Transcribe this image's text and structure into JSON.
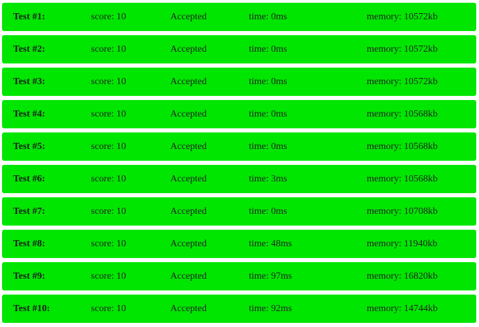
{
  "tests": [
    {
      "name": "Test #1:",
      "score": "score: 10",
      "status": "Accepted",
      "time": "time: 0ms",
      "memory": "memory: 10572kb"
    },
    {
      "name": "Test #2:",
      "score": "score: 10",
      "status": "Accepted",
      "time": "time: 0ms",
      "memory": "memory: 10572kb"
    },
    {
      "name": "Test #3:",
      "score": "score: 10",
      "status": "Accepted",
      "time": "time: 0ms",
      "memory": "memory: 10572kb"
    },
    {
      "name": "Test #4:",
      "score": "score: 10",
      "status": "Accepted",
      "time": "time: 0ms",
      "memory": "memory: 10568kb"
    },
    {
      "name": "Test #5:",
      "score": "score: 10",
      "status": "Accepted",
      "time": "time: 0ms",
      "memory": "memory: 10568kb"
    },
    {
      "name": "Test #6:",
      "score": "score: 10",
      "status": "Accepted",
      "time": "time: 3ms",
      "memory": "memory: 10568kb"
    },
    {
      "name": "Test #7:",
      "score": "score: 10",
      "status": "Accepted",
      "time": "time: 0ms",
      "memory": "memory: 10708kb"
    },
    {
      "name": "Test #8:",
      "score": "score: 10",
      "status": "Accepted",
      "time": "time: 48ms",
      "memory": "memory: 11940kb"
    },
    {
      "name": "Test #9:",
      "score": "score: 10",
      "status": "Accepted",
      "time": "time: 97ms",
      "memory": "memory: 16820kb"
    },
    {
      "name": "Test #10:",
      "score": "score: 10",
      "status": "Accepted",
      "time": "time: 92ms",
      "memory": "memory: 14744kb"
    }
  ],
  "colors": {
    "accepted_background": "#00e600",
    "text": "#222222"
  }
}
